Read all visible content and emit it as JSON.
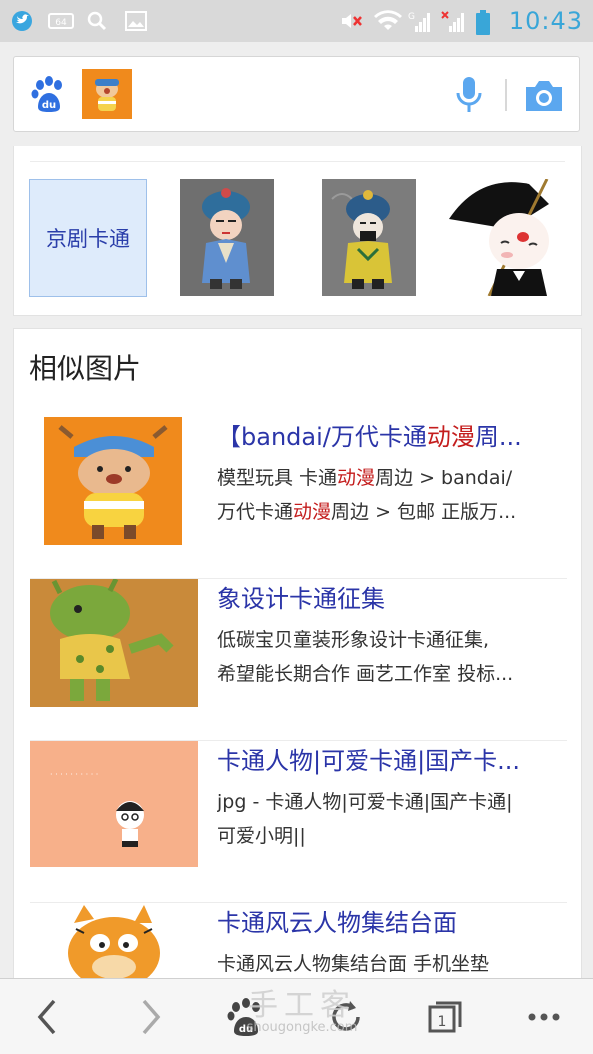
{
  "status_bar": {
    "time": "10:43",
    "icons": [
      "twitter-bird-icon",
      "hd-icon",
      "search-icon",
      "image-icon",
      "mute-icon",
      "wifi-icon",
      "signal-g-icon",
      "signal-x-icon",
      "battery-icon"
    ],
    "accent": "#39a6d8"
  },
  "search": {
    "logo": "baidu-paw-icon",
    "mic": "microphone-icon",
    "camera": "camera-icon",
    "accent": "#2f8de4"
  },
  "related": {
    "first_label": "京剧卡通"
  },
  "similar": {
    "heading": "相似图片",
    "items": [
      {
        "title_pre": "【bandai/万代卡通",
        "title_hl": "动漫",
        "title_post": "周...",
        "line1_pre": "模型玩具 卡通",
        "line1_hl": "动漫",
        "line1_post": "周边 > bandai/",
        "line2_pre": "万代卡通",
        "line2_hl": "动漫",
        "line2_post": "周边 > 包邮 正版万..."
      },
      {
        "title": "象设计卡通征集",
        "line1": "低碳宝贝童装形象设计卡通征集,",
        "line2": "希望能长期合作 画艺工作室 投标..."
      },
      {
        "title": "卡通人物|可爱卡通|国产卡...",
        "line1": "jpg - 卡通人物|可爱卡通|国产卡通|",
        "line2": "可爱小明||"
      },
      {
        "title": "卡通风云人物集结台面",
        "line1": "卡通风云人物集结台面 手机坐垫"
      }
    ]
  },
  "bottom_bar": {
    "page_count": "1",
    "watermark_cn": "手工客",
    "watermark_en": "shougongke.com"
  }
}
